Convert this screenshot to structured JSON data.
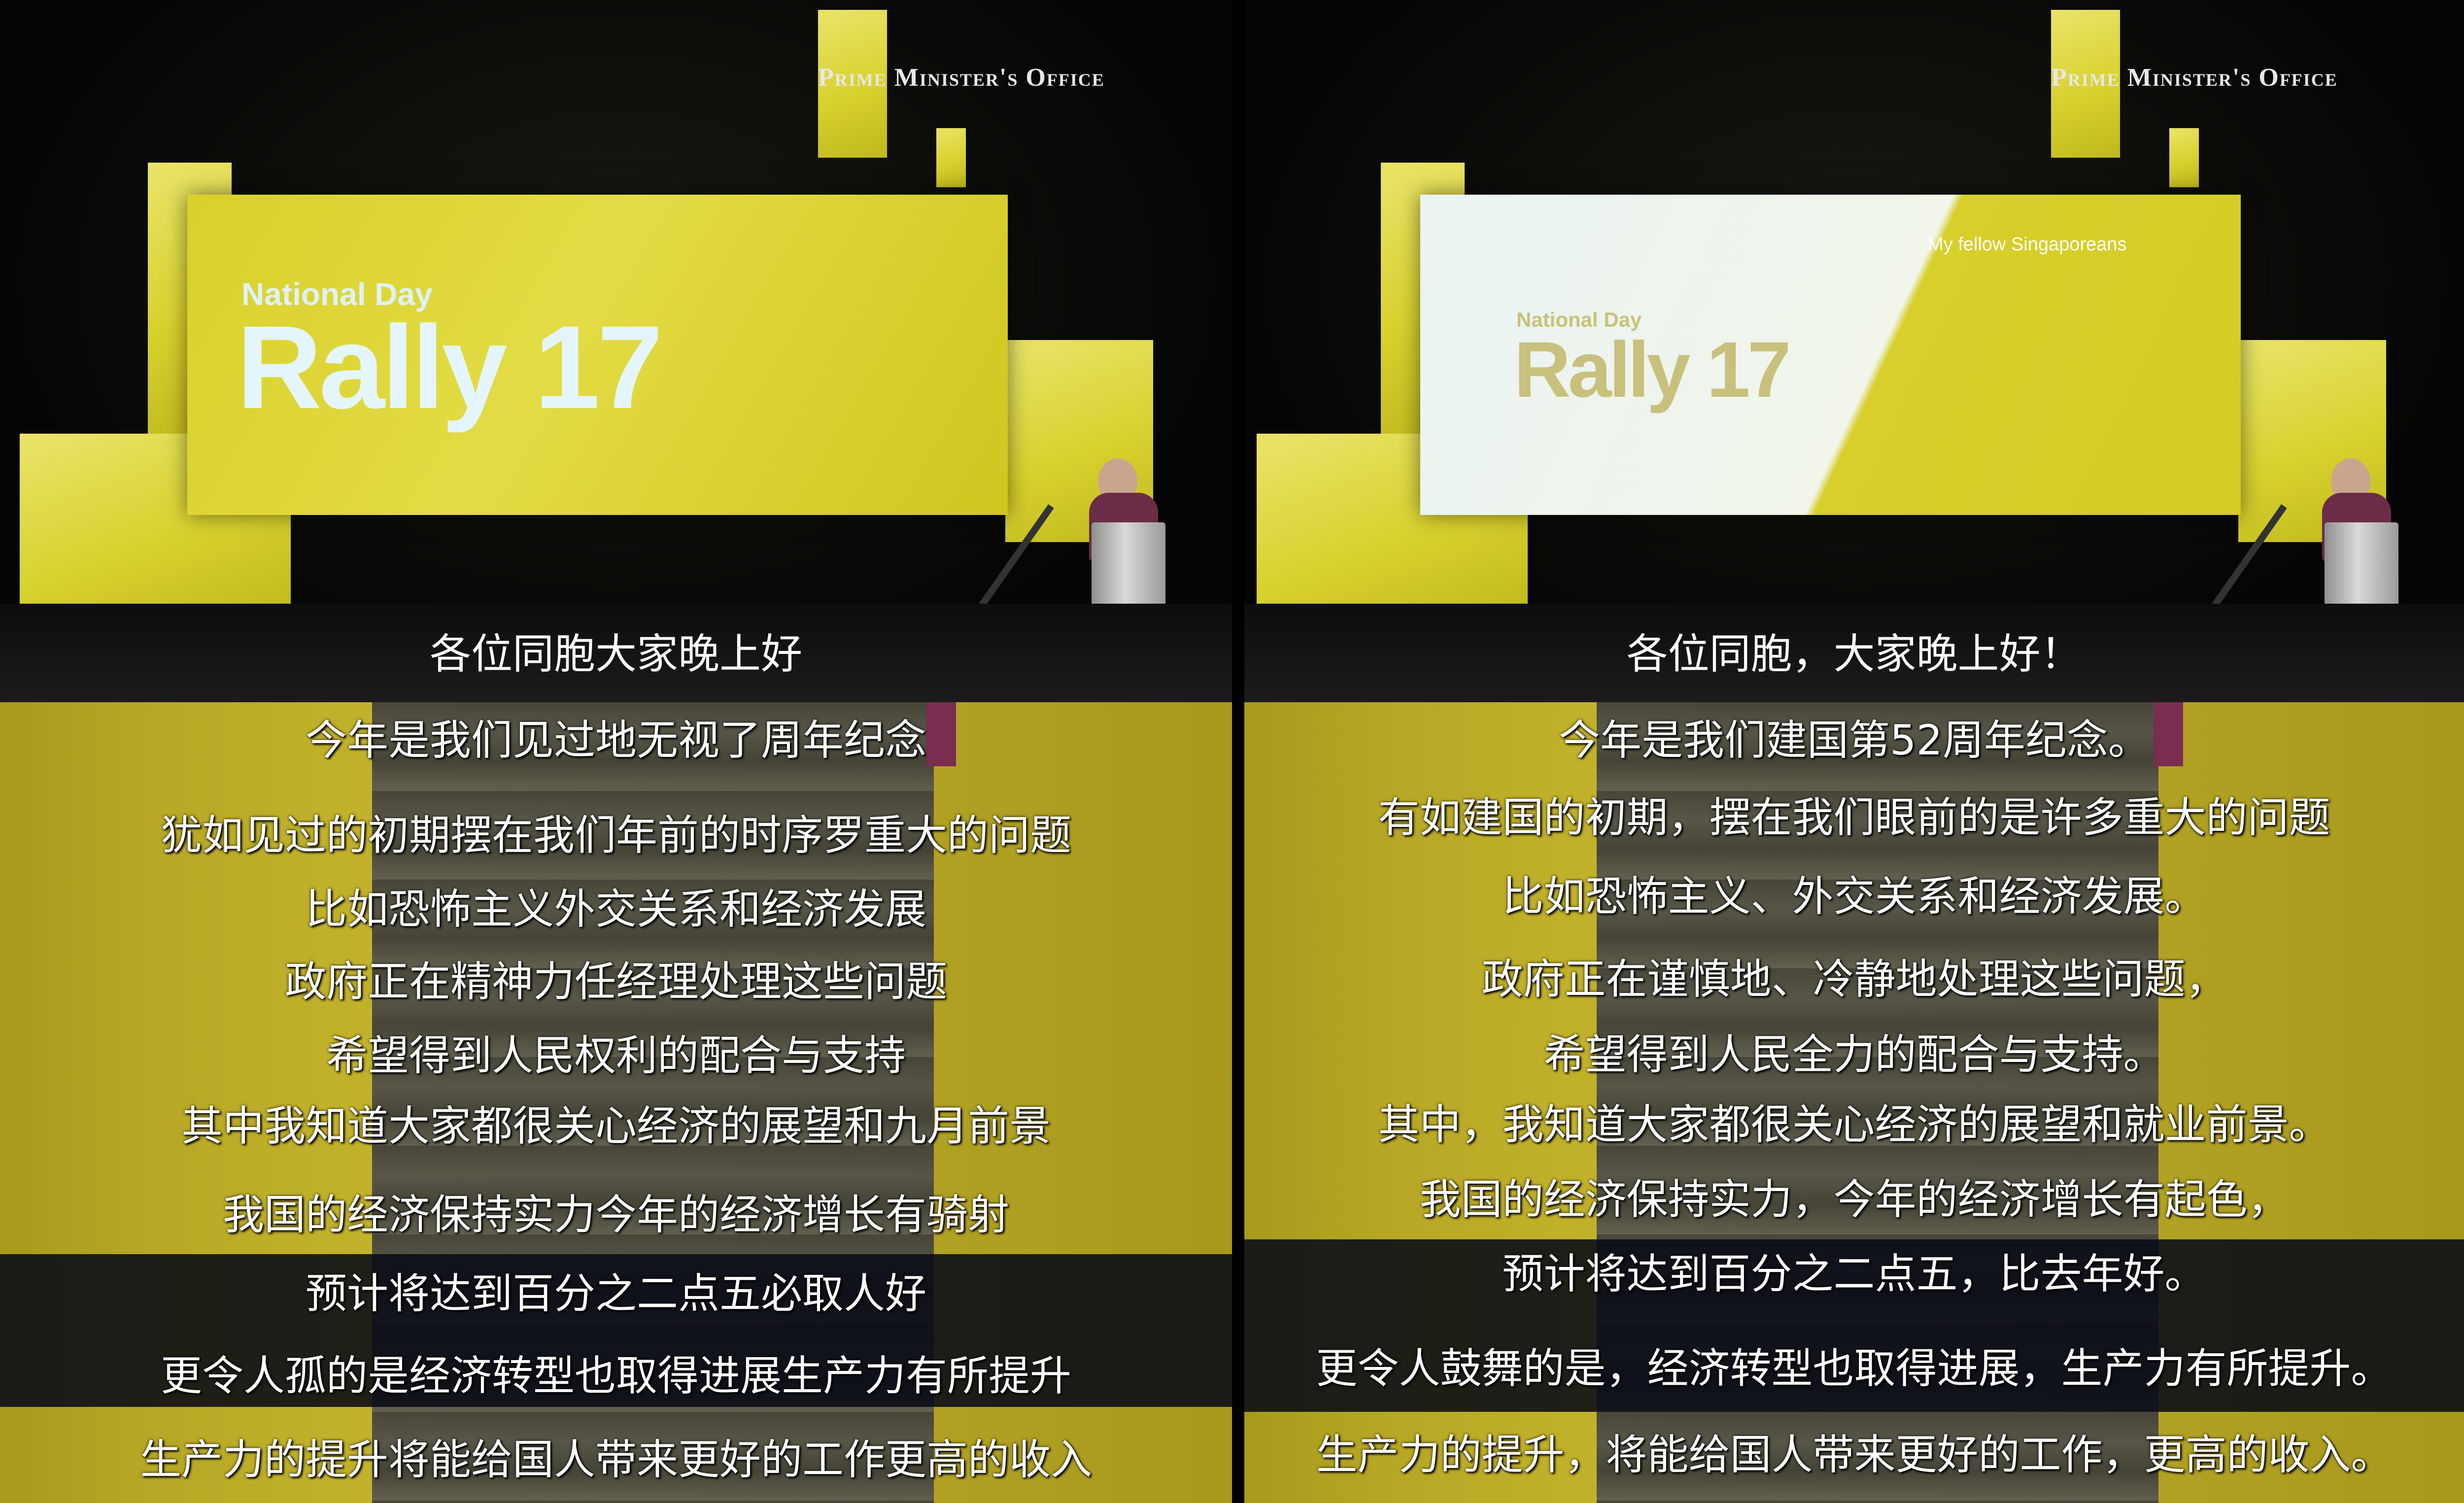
{
  "left": {
    "pmo_logo": "Prime Minister's Office",
    "slide": {
      "small_title": "National Day",
      "big_title": "Rally 17"
    },
    "top_subtitle": "各位同胞大家晚上好",
    "subtitles": [
      "今年是我们见过地无视了周年纪念",
      "犹如见过的初期摆在我们年前的时序罗重大的问题",
      "比如恐怖主义外交关系和经济发展",
      "政府正在精神力任经理处理这些问题",
      "希望得到人民权利的配合与支持",
      "其中我知道大家都很关心经济的展望和九月前景",
      "我国的经济保持实力今年的经济增长有骑射",
      "预计将达到百分之二点五必取人好",
      "更令人孤的是经济转型也取得进展生产力有所提升",
      "生产力的提升将能给国人带来更好的工作更高的收入"
    ]
  },
  "right": {
    "pmo_logo": "Prime Minister's Office",
    "slide": {
      "caption": "My fellow Singaporeans",
      "small_title": "National Day",
      "big_title": "Rally 17"
    },
    "top_subtitle": "各位同胞，大家晚上好！",
    "subtitles": [
      "今年是我们建国第52周年纪念。",
      "有如建国的初期，摆在我们眼前的是许多重大的问题",
      "比如恐怖主义、外交关系和经济发展。",
      "政府正在谨慎地、冷静地处理这些问题，",
      "希望得到人民全力的配合与支持。",
      "其中，我知道大家都很关心经济的展望和就业前景。",
      "我国的经济保持实力，今年的经济增长有起色，",
      "预计将达到百分之二点五，比去年好。",
      "更令人鼓舞的是，经济转型也取得进展，生产力有所提升。",
      "生产力的提升，将能给国人带来更好的工作，更高的收入。"
    ]
  },
  "colors": {
    "stage_yellow": "#d8d22f",
    "subtitle_text": "#ffffff",
    "subtitle_band": "#080a16",
    "background": "#0a0a0a"
  }
}
